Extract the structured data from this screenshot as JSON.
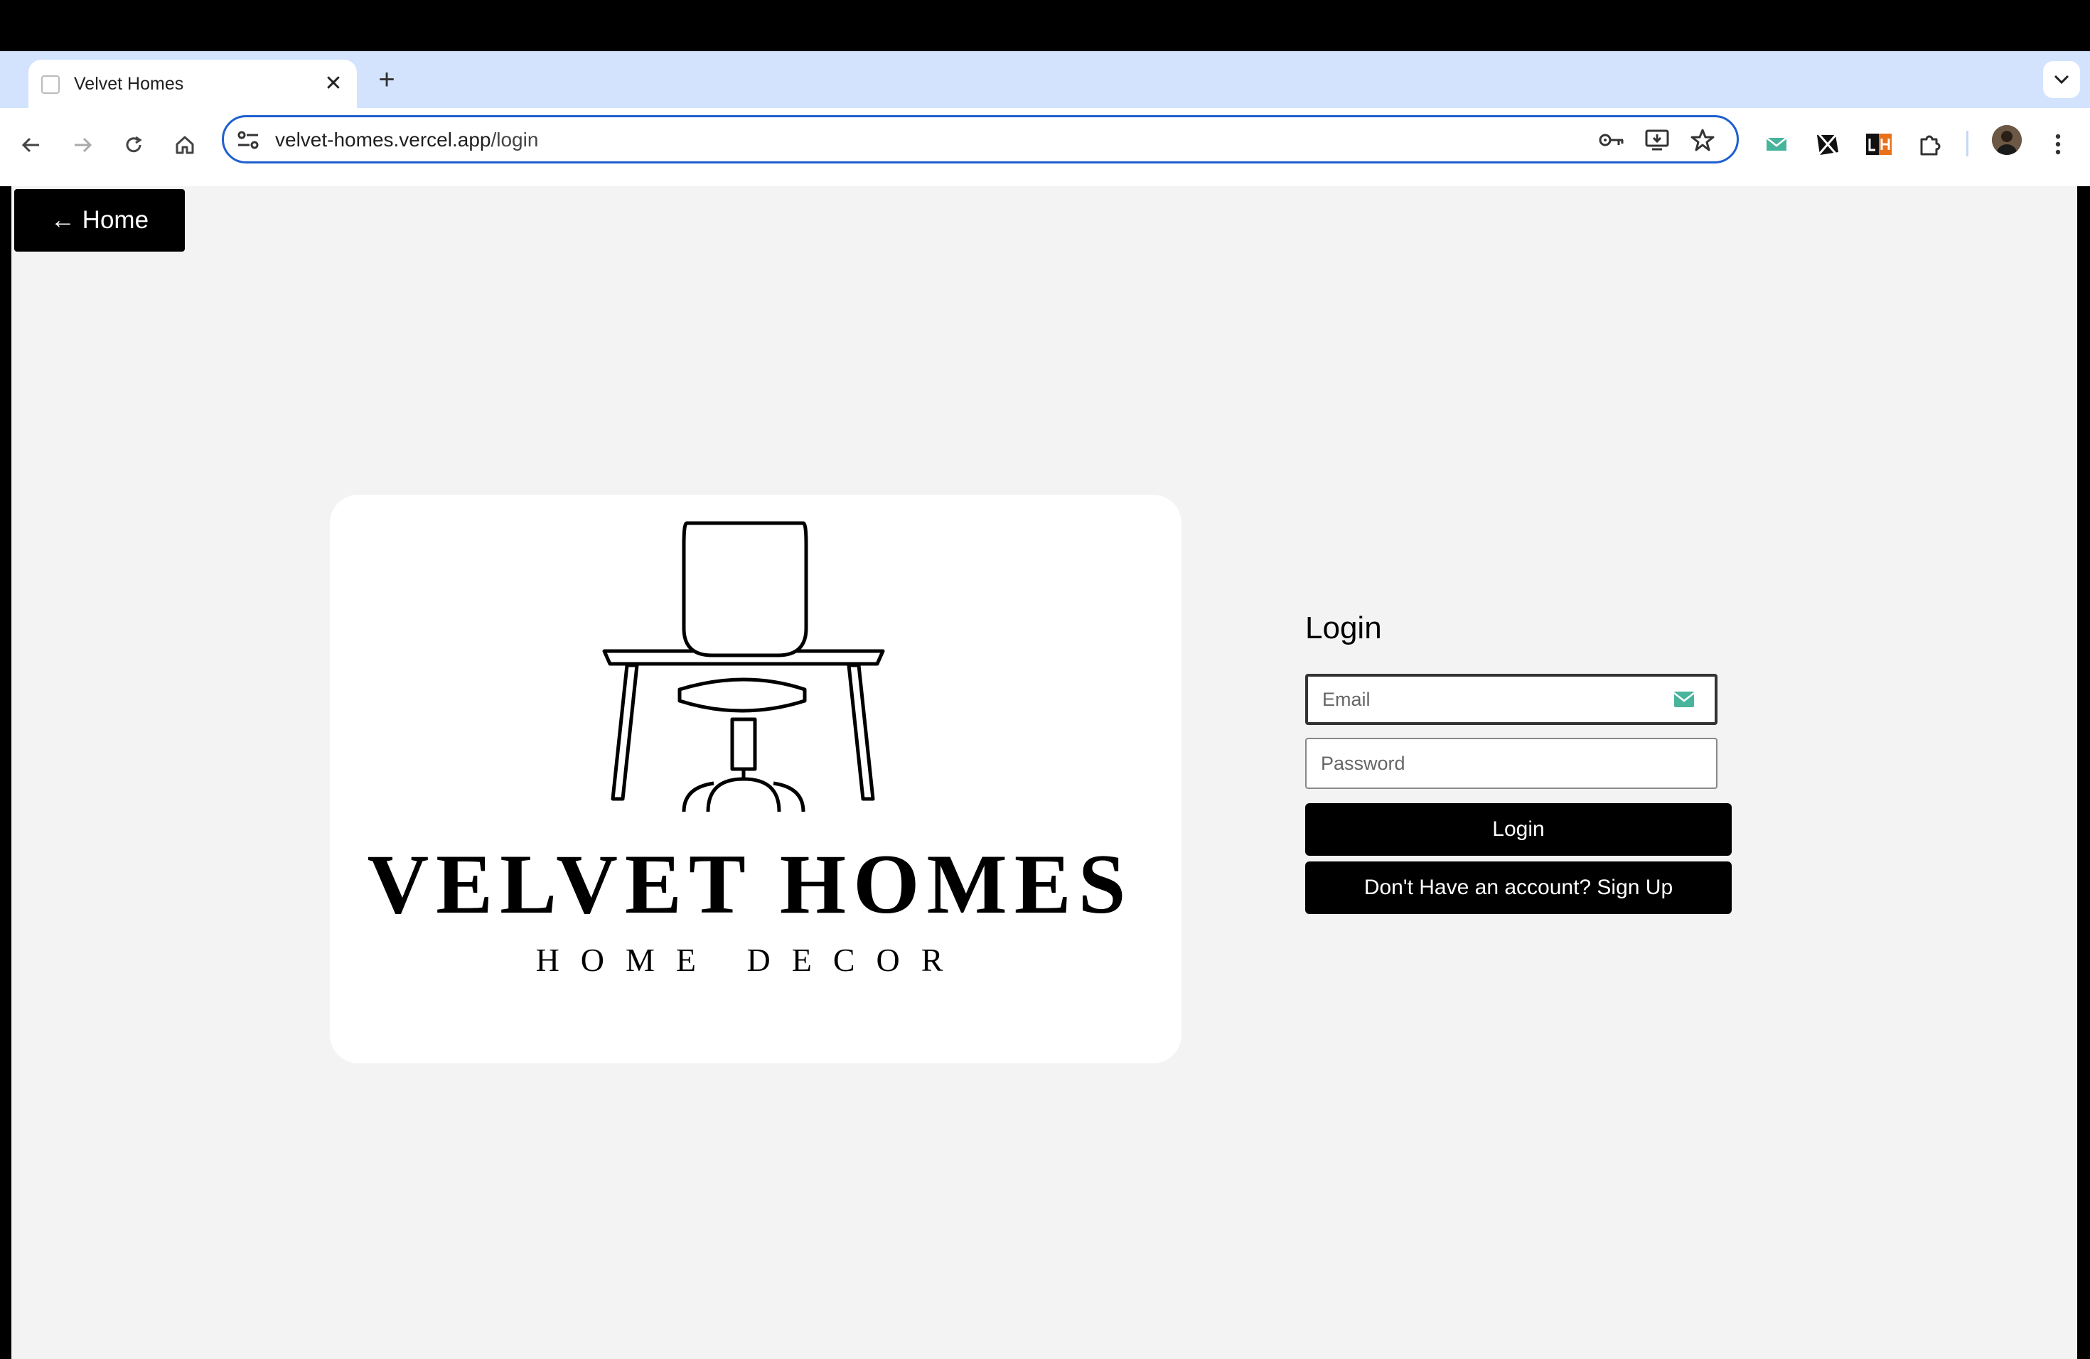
{
  "browser": {
    "tab": {
      "title": "Velvet Homes"
    },
    "url": {
      "host": "velvet-homes.vercel.app",
      "path": "/login"
    }
  },
  "page": {
    "home_button": "← Home",
    "logo": {
      "brand": "VELVET HOMES",
      "tagline": "HOME DECOR"
    },
    "login_form": {
      "title": "Login",
      "email_placeholder": "Email",
      "password_placeholder": "Password",
      "login_button": "Login",
      "signup_button": "Don't Have an account? Sign Up"
    }
  },
  "colors": {
    "accent_blue": "#1f5fcf",
    "tab_strip": "#d3e3fd",
    "page_background": "#f3f3f3",
    "button_background": "#000000"
  }
}
